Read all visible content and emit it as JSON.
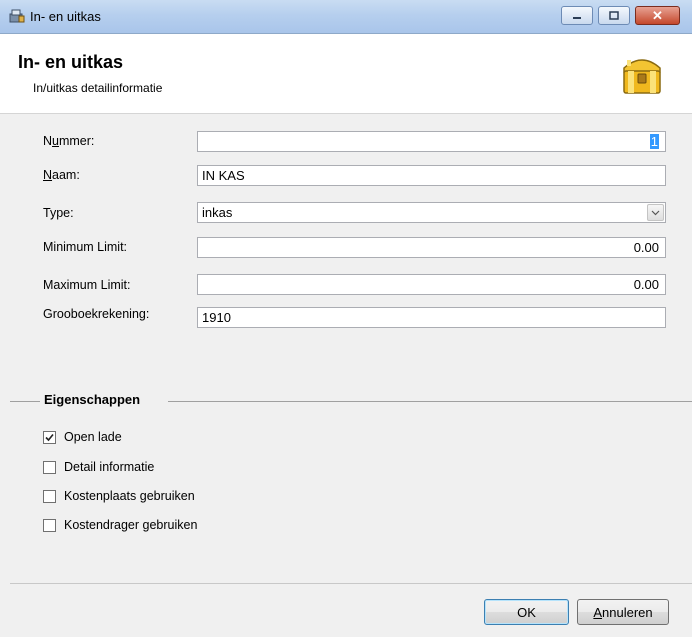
{
  "window": {
    "title": "In- en uitkas",
    "close_glyph": "✕"
  },
  "header": {
    "title": "In- en uitkas",
    "subtitle": "In/uitkas detailinformatie",
    "icon": "treasure-chest-icon"
  },
  "form": {
    "nummer": {
      "label_prefix": "N",
      "label_underlined": "u",
      "label_rest": "mmer:",
      "value": "1"
    },
    "naam": {
      "label_underlined": "N",
      "label_rest": "aam:",
      "value": "IN KAS"
    },
    "type": {
      "label": "Type:",
      "value": "inkas"
    },
    "min_limit": {
      "label": "Minimum Limit:",
      "value": "0.00"
    },
    "max_limit": {
      "label": "Maximum Limit:",
      "value": "0.00"
    },
    "grootboek": {
      "label": "Grooboekrekening:",
      "value": "1910"
    }
  },
  "properties": {
    "title": "Eigenschappen",
    "items": [
      {
        "label": "Open lade",
        "checked": true
      },
      {
        "label": "Detail informatie",
        "checked": false
      },
      {
        "label": "Kostenplaats gebruiken",
        "checked": false
      },
      {
        "label": "Kostendrager gebruiken",
        "checked": false
      }
    ]
  },
  "buttons": {
    "ok": "OK",
    "cancel_underlined": "A",
    "cancel_rest": "nnuleren"
  },
  "colors": {
    "titlebar": "#b6cfee",
    "close_button": "#c4482c",
    "selection": "#3399ff"
  }
}
